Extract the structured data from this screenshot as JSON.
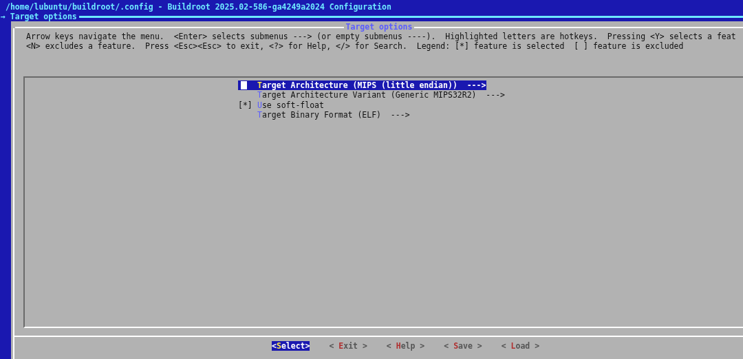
{
  "window": {
    "title": "/home/lubuntu/buildroot/.config - Buildroot 2025.02-586-ga4249a2024 Configuration"
  },
  "breadcrumb": "→ Target options",
  "dialog": {
    "title": "Target options",
    "help_lines": [
      "Arrow keys navigate the menu.  <Enter> selects submenus ---> (or empty submenus ----).  Highlighted letters are hotkeys.  Pressing <Y> selects a feat",
      "<N> excludes a feature.  Press <Esc><Esc> to exit, <?> for Help, </> for Search.  Legend: [*] feature is selected  [ ] feature is excluded"
    ],
    "items": [
      {
        "kind": "menu",
        "label": "Target Architecture (MIPS (little endian))",
        "arrow": "--->",
        "selected": true
      },
      {
        "kind": "menu",
        "label": "Target Architecture Variant (Generic MIPS32R2)",
        "arrow": "--->",
        "selected": false
      },
      {
        "kind": "bool",
        "checkbox": "[*]",
        "checked": true,
        "label": "Use soft-float",
        "selected": false
      },
      {
        "kind": "menu",
        "label": "Target Binary Format (ELF)",
        "arrow": "--->",
        "selected": false
      }
    ],
    "buttons": [
      {
        "label": "<Select>",
        "selected": true
      },
      {
        "label": "< Exit >",
        "selected": false
      },
      {
        "label": "< Help >",
        "selected": false
      },
      {
        "label": "< Save >",
        "selected": false
      },
      {
        "label": "< Load >",
        "selected": false
      }
    ]
  }
}
